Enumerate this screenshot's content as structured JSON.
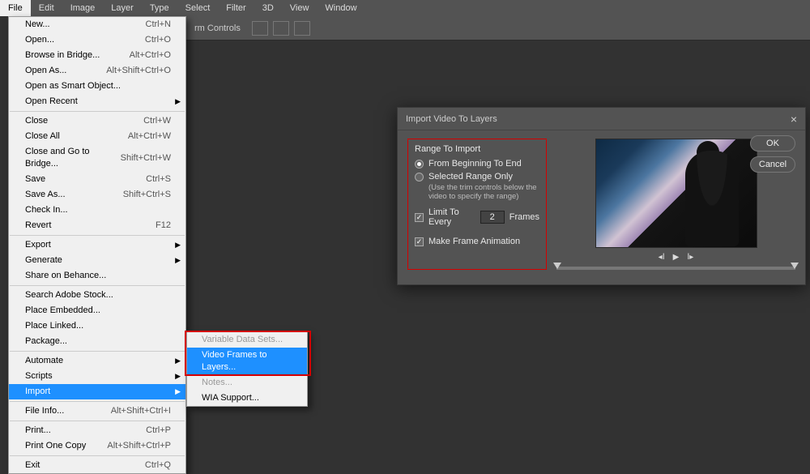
{
  "menubar": [
    "File",
    "Edit",
    "Image",
    "Layer",
    "Type",
    "Select",
    "Filter",
    "3D",
    "View",
    "Window"
  ],
  "menubar_active_index": 0,
  "toolbar": {
    "label": "rm Controls"
  },
  "file_menu": {
    "groups": [
      [
        {
          "label": "New...",
          "shortcut": "Ctrl+N",
          "enabled": true
        },
        {
          "label": "Open...",
          "shortcut": "Ctrl+O",
          "enabled": true
        },
        {
          "label": "Browse in Bridge...",
          "shortcut": "Alt+Ctrl+O",
          "enabled": true
        },
        {
          "label": "Open As...",
          "shortcut": "Alt+Shift+Ctrl+O",
          "enabled": true
        },
        {
          "label": "Open as Smart Object...",
          "shortcut": "",
          "enabled": true
        },
        {
          "label": "Open Recent",
          "shortcut": "",
          "enabled": true,
          "submenu": true
        }
      ],
      [
        {
          "label": "Close",
          "shortcut": "Ctrl+W",
          "enabled": true
        },
        {
          "label": "Close All",
          "shortcut": "Alt+Ctrl+W",
          "enabled": true
        },
        {
          "label": "Close and Go to Bridge...",
          "shortcut": "Shift+Ctrl+W",
          "enabled": true
        },
        {
          "label": "Save",
          "shortcut": "Ctrl+S",
          "enabled": true
        },
        {
          "label": "Save As...",
          "shortcut": "Shift+Ctrl+S",
          "enabled": true
        },
        {
          "label": "Check In...",
          "shortcut": "",
          "enabled": true
        },
        {
          "label": "Revert",
          "shortcut": "F12",
          "enabled": true
        }
      ],
      [
        {
          "label": "Export",
          "shortcut": "",
          "enabled": true,
          "submenu": true
        },
        {
          "label": "Generate",
          "shortcut": "",
          "enabled": true,
          "submenu": true
        },
        {
          "label": "Share on Behance...",
          "shortcut": "",
          "enabled": true
        }
      ],
      [
        {
          "label": "Search Adobe Stock...",
          "shortcut": "",
          "enabled": true
        },
        {
          "label": "Place Embedded...",
          "shortcut": "",
          "enabled": true
        },
        {
          "label": "Place Linked...",
          "shortcut": "",
          "enabled": true
        },
        {
          "label": "Package...",
          "shortcut": "",
          "enabled": true
        }
      ],
      [
        {
          "label": "Automate",
          "shortcut": "",
          "enabled": true,
          "submenu": true
        },
        {
          "label": "Scripts",
          "shortcut": "",
          "enabled": true,
          "submenu": true
        },
        {
          "label": "Import",
          "shortcut": "",
          "enabled": true,
          "submenu": true,
          "highlight": true
        }
      ],
      [
        {
          "label": "File Info...",
          "shortcut": "Alt+Shift+Ctrl+I",
          "enabled": true
        }
      ],
      [
        {
          "label": "Print...",
          "shortcut": "Ctrl+P",
          "enabled": true
        },
        {
          "label": "Print One Copy",
          "shortcut": "Alt+Shift+Ctrl+P",
          "enabled": true
        }
      ],
      [
        {
          "label": "Exit",
          "shortcut": "Ctrl+Q",
          "enabled": true
        }
      ]
    ]
  },
  "import_submenu": {
    "items": [
      {
        "label": "Variable Data Sets...",
        "enabled": false
      },
      {
        "label": "Video Frames to Layers...",
        "enabled": true,
        "highlight": true
      },
      {
        "label": "Notes...",
        "enabled": false
      },
      {
        "label": "WIA Support...",
        "enabled": true
      }
    ]
  },
  "dialog": {
    "title": "Import Video To Layers",
    "group_title": "Range To Import",
    "opt_beginning": "From Beginning To End",
    "opt_selected": "Selected Range Only",
    "selected_note": "(Use the trim controls below the video to specify the range)",
    "limit_label": "Limit To Every",
    "limit_value": "2",
    "frames_label": "Frames",
    "make_anim": "Make Frame Animation",
    "radio_checked": "beginning",
    "limit_checked": true,
    "make_anim_checked": true,
    "ok": "OK",
    "cancel": "Cancel"
  }
}
